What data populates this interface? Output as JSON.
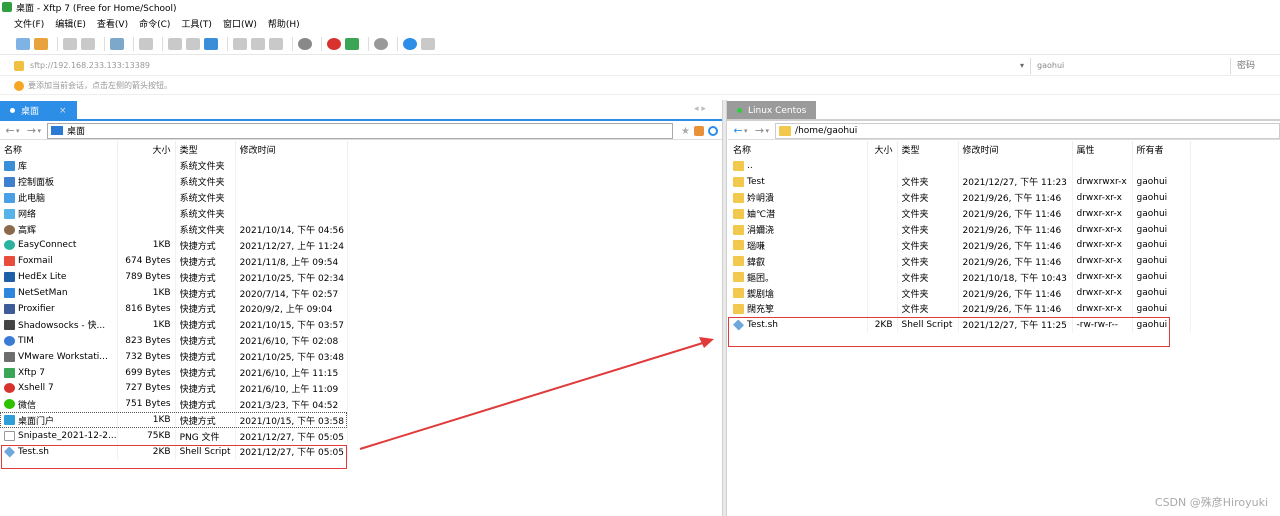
{
  "window": {
    "title": "桌面 - Xftp 7 (Free for Home/School)"
  },
  "menu": [
    "文件(F)",
    "编辑(E)",
    "查看(V)",
    "命令(C)",
    "工具(T)",
    "窗口(W)",
    "帮助(H)"
  ],
  "address": {
    "host_value": "sftp://192.168.233.133:13389",
    "user_value": "gaohui",
    "password_placeholder": "密码"
  },
  "hint": "要添加当前会话，点击左侧的箭头按钮。",
  "left_panel": {
    "tab_label": "桌面",
    "tab_close": "×",
    "path": "桌面",
    "columns": [
      "名称",
      "大小",
      "类型",
      "修改时间"
    ],
    "rows": [
      {
        "icon": "folder-blue",
        "name": "库",
        "size": "",
        "type": "系统文件夹",
        "modified": ""
      },
      {
        "icon": "panel",
        "name": "控制面板",
        "size": "",
        "type": "系统文件夹",
        "modified": ""
      },
      {
        "icon": "pc",
        "name": "此电脑",
        "size": "",
        "type": "系统文件夹",
        "modified": ""
      },
      {
        "icon": "net",
        "name": "网络",
        "size": "",
        "type": "系统文件夹",
        "modified": ""
      },
      {
        "icon": "user",
        "name": "高辉",
        "size": "",
        "type": "系统文件夹",
        "modified": "2021/10/14, 下午 04:56"
      },
      {
        "icon": "easy",
        "name": "EasyConnect",
        "size": "1KB",
        "type": "快捷方式",
        "modified": "2021/12/27, 上午 11:24"
      },
      {
        "icon": "fox",
        "name": "Foxmail",
        "size": "674 Bytes",
        "type": "快捷方式",
        "modified": "2021/11/8, 上午 09:54"
      },
      {
        "icon": "hedex",
        "name": "HedEx Lite",
        "size": "789 Bytes",
        "type": "快捷方式",
        "modified": "2021/10/25, 下午 02:34"
      },
      {
        "icon": "netset",
        "name": "NetSetMan",
        "size": "1KB",
        "type": "快捷方式",
        "modified": "2020/7/14, 下午 02:57"
      },
      {
        "icon": "prox",
        "name": "Proxifier",
        "size": "816 Bytes",
        "type": "快捷方式",
        "modified": "2020/9/2, 上午 09:04"
      },
      {
        "icon": "ss",
        "name": "Shadowsocks - 快...",
        "size": "1KB",
        "type": "快捷方式",
        "modified": "2021/10/15, 下午 03:57"
      },
      {
        "icon": "tim",
        "name": "TIM",
        "size": "823 Bytes",
        "type": "快捷方式",
        "modified": "2021/6/10, 下午 02:08"
      },
      {
        "icon": "vm",
        "name": "VMware Workstati...",
        "size": "732 Bytes",
        "type": "快捷方式",
        "modified": "2021/10/25, 下午 03:48"
      },
      {
        "icon": "xftp",
        "name": "Xftp 7",
        "size": "699 Bytes",
        "type": "快捷方式",
        "modified": "2021/6/10, 上午 11:15"
      },
      {
        "icon": "xshell",
        "name": "Xshell 7",
        "size": "727 Bytes",
        "type": "快捷方式",
        "modified": "2021/6/10, 上午 11:09"
      },
      {
        "icon": "wx",
        "name": "微信",
        "size": "751 Bytes",
        "type": "快捷方式",
        "modified": "2021/3/23, 下午 04:52"
      },
      {
        "icon": "portal",
        "name": "桌面门户",
        "size": "1KB",
        "type": "快捷方式",
        "modified": "2021/10/15, 下午 03:58"
      },
      {
        "icon": "png",
        "name": "Snipaste_2021-12-2...",
        "size": "75KB",
        "type": "PNG 文件",
        "modified": "2021/12/27, 下午 05:05"
      },
      {
        "icon": "sh",
        "name": "Test.sh",
        "size": "2KB",
        "type": "Shell Script",
        "modified": "2021/12/27, 下午 05:05"
      }
    ]
  },
  "right_panel": {
    "tab_label": "Linux Centos",
    "path": "/home/gaohui",
    "columns": [
      "名称",
      "大小",
      "类型",
      "修改时间",
      "属性",
      "所有者"
    ],
    "rows": [
      {
        "icon": "up",
        "name": "..",
        "size": "",
        "type": "",
        "modified": "",
        "attr": "",
        "owner": ""
      },
      {
        "icon": "folder",
        "name": "Test",
        "size": "",
        "type": "文件夹",
        "modified": "2021/12/27, 下午 11:23",
        "attr": "drwxrwxr-x",
        "owner": "gaohui"
      },
      {
        "icon": "folder",
        "name": "妗岄潰",
        "size": "",
        "type": "文件夹",
        "modified": "2021/9/26, 下午 11:46",
        "attr": "drwxr-xr-x",
        "owner": "gaohui"
      },
      {
        "icon": "folder",
        "name": "妯℃澘",
        "size": "",
        "type": "文件夹",
        "modified": "2021/9/26, 下午 11:46",
        "attr": "drwxr-xr-x",
        "owner": "gaohui"
      },
      {
        "icon": "folder",
        "name": "涓嬭浇",
        "size": "",
        "type": "文件夹",
        "modified": "2021/9/26, 下午 11:46",
        "attr": "drwxr-xr-x",
        "owner": "gaohui"
      },
      {
        "icon": "folder",
        "name": "瑙嗛",
        "size": "",
        "type": "文件夹",
        "modified": "2021/9/26, 下午 11:46",
        "attr": "drwxr-xr-x",
        "owner": "gaohui"
      },
      {
        "icon": "folder",
        "name": "鍏叡",
        "size": "",
        "type": "文件夹",
        "modified": "2021/9/26, 下午 11:46",
        "attr": "drwxr-xr-x",
        "owner": "gaohui"
      },
      {
        "icon": "folder",
        "name": "鏂囨。",
        "size": "",
        "type": "文件夹",
        "modified": "2021/10/18, 下午 10:43",
        "attr": "drwxr-xr-x",
        "owner": "gaohui"
      },
      {
        "icon": "folder",
        "name": "鍥剧墖",
        "size": "",
        "type": "文件夹",
        "modified": "2021/9/26, 下午 11:46",
        "attr": "drwxr-xr-x",
        "owner": "gaohui"
      },
      {
        "icon": "folder",
        "name": "闊充箰",
        "size": "",
        "type": "文件夹",
        "modified": "2021/9/26, 下午 11:46",
        "attr": "drwxr-xr-x",
        "owner": "gaohui"
      },
      {
        "icon": "sh",
        "name": "Test.sh",
        "size": "2KB",
        "type": "Shell Script",
        "modified": "2021/12/27, 下午 11:25",
        "attr": "-rw-rw-r--",
        "owner": "gaohui"
      }
    ]
  },
  "watermark": "CSDN @殊彦Hiroyuki",
  "colors": {
    "accent": "#2d8ee8",
    "highlight": "#e03a3a",
    "folder": "#f2c94c"
  }
}
